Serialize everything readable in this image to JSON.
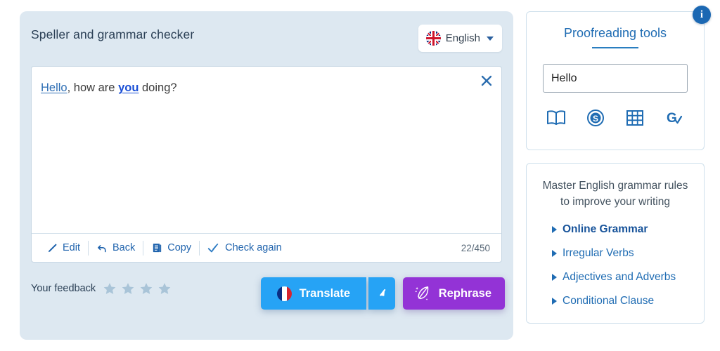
{
  "checker": {
    "title": "Speller and grammar checker",
    "language": {
      "name": "English",
      "flag_icon": "uk-flag-icon",
      "caret_icon": "chevron-down-icon"
    },
    "editor": {
      "text_before": "",
      "token_1": "Hello",
      "text_mid": ", how are ",
      "token_2": "you",
      "text_after": " doing?",
      "close_icon": "close-icon"
    },
    "toolbar": {
      "edit_label": "Edit",
      "edit_icon": "pencil-icon",
      "back_label": "Back",
      "back_icon": "undo-arrow-icon",
      "copy_label": "Copy",
      "copy_icon": "copy-document-icon",
      "check_label": "Check again",
      "check_icon": "double-check-icon",
      "counter": "22/450"
    },
    "feedback": {
      "label": "Your feedback",
      "stars": 4,
      "star_icon": "star-icon",
      "star_color": "#a9c4d8"
    },
    "actions": {
      "translate_label": "Translate",
      "translate_flag_icon": "france-flag-icon",
      "translate_arrow_icon": "cursor-arrow-icon",
      "translate_color": "#26a3f5",
      "rephrase_label": "Rephrase",
      "rephrase_icon": "quill-sparkle-icon",
      "rephrase_color": "#9333d6"
    }
  },
  "tools_card": {
    "title": "Proofreading tools",
    "info_icon": "info-icon",
    "info_glyph": "i",
    "input_value": "Hello",
    "input_placeholder": "Hello",
    "icons": [
      {
        "name": "dictionary-book-icon"
      },
      {
        "name": "synonyms-circle-s-icon"
      },
      {
        "name": "conjugation-grid-icon"
      },
      {
        "name": "grammar-g-check-icon"
      }
    ],
    "accent_color": "#1f6cb3"
  },
  "promo_card": {
    "heading": "Master English grammar rules to improve your writing",
    "links": [
      {
        "label": "Online Grammar",
        "bold": true
      },
      {
        "label": "Irregular Verbs",
        "bold": false
      },
      {
        "label": "Adjectives and Adverbs",
        "bold": false
      },
      {
        "label": "Conditional Clause",
        "bold": false
      }
    ]
  }
}
